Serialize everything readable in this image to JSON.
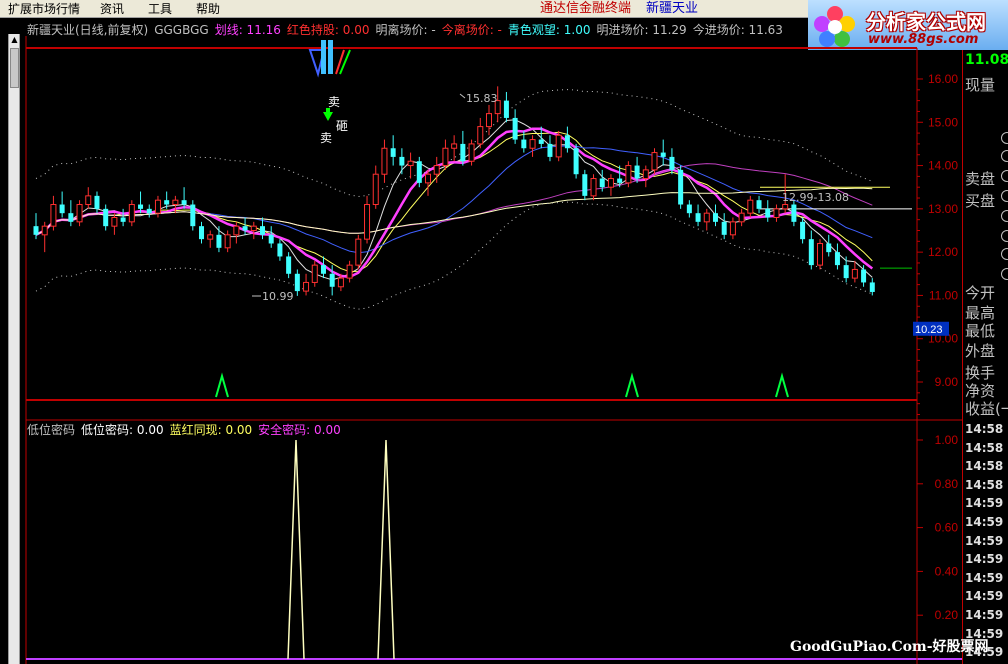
{
  "menu": {
    "items": [
      "扩展市场行情",
      "资讯",
      "工具",
      "帮助"
    ],
    "app_title": "通达信金融终端",
    "stock_name": "新疆天业"
  },
  "logo": {
    "text": "分析家公式网",
    "url": "www.88gs.com"
  },
  "main_title": [
    {
      "text": "新疆天业(日线,前复权)",
      "color": "#c0c0c0"
    },
    {
      "text": "GGGBGG",
      "color": "#c0c0c0"
    },
    {
      "text": "划线: 11.16",
      "color": "#ff40ff"
    },
    {
      "text": "红色持股: 0.00",
      "color": "#ff3030"
    },
    {
      "text": "明离场价: -",
      "color": "#c0c0c0"
    },
    {
      "text": "今离场价: -",
      "color": "#ff3030"
    },
    {
      "text": "青色观望: 1.00",
      "color": "#40ffff"
    },
    {
      "text": "明进场价: 11.29",
      "color": "#c0c0c0"
    },
    {
      "text": "今进场价: 11.63",
      "color": "#c0c0c0"
    }
  ],
  "sub_title": [
    {
      "text": "低位密码",
      "color": "#c0c0c0"
    },
    {
      "text": "低位密码: 0.00",
      "color": "#ffffff"
    },
    {
      "text": "蓝红同现: 0.00",
      "color": "#ffff60"
    },
    {
      "text": "安全密码: 0.00",
      "color": "#ff40ff"
    }
  ],
  "price_axis": [
    "16.00",
    "15.00",
    "14.00",
    "13.00",
    "12.00",
    "11.00",
    "10.00",
    "9.00"
  ],
  "price_highlight": "10.23",
  "sub_axis": [
    "1.00",
    "0.80",
    "0.60",
    "0.40",
    "0.20"
  ],
  "annotations": {
    "high_label": "15.83",
    "low_label": "10.99",
    "range_label": "12.99-13.08",
    "sell_1": "卖",
    "sell_2": "卖",
    "smash": "砸"
  },
  "right_panel": {
    "price": "11.08",
    "labels": [
      "现量",
      "卖盘",
      "买盘",
      "今开",
      "最高",
      "最低",
      "外盘",
      "换手",
      "净资",
      "收益(一"
    ],
    "times": [
      "14:58",
      "14:58",
      "14:58",
      "14:58",
      "14:59",
      "14:59",
      "14:59",
      "14:59",
      "14:59",
      "14:59",
      "14:59",
      "14:59",
      "14:59"
    ]
  },
  "watermark": "GoodGuPiao.Com-好股票网",
  "colors": {
    "up": "#ff3030",
    "down": "#40ffff",
    "grid": "#c00000"
  },
  "chart_data": {
    "type": "candlestick",
    "ylim": [
      8.7,
      16.6
    ],
    "candles": [
      [
        12.6,
        12.9,
        12.3,
        12.4
      ],
      [
        12.4,
        12.7,
        12.0,
        12.6
      ],
      [
        12.6,
        13.3,
        12.5,
        13.1
      ],
      [
        13.1,
        13.4,
        12.8,
        12.9
      ],
      [
        12.9,
        13.2,
        12.6,
        12.7
      ],
      [
        12.7,
        13.2,
        12.6,
        13.1
      ],
      [
        13.1,
        13.5,
        13.0,
        13.3
      ],
      [
        13.3,
        13.4,
        12.9,
        13.0
      ],
      [
        13.0,
        13.1,
        12.5,
        12.6
      ],
      [
        12.6,
        12.9,
        12.4,
        12.8
      ],
      [
        12.8,
        13.0,
        12.6,
        12.7
      ],
      [
        12.7,
        13.2,
        12.6,
        13.1
      ],
      [
        13.1,
        13.4,
        12.9,
        13.0
      ],
      [
        13.0,
        13.1,
        12.8,
        12.9
      ],
      [
        12.9,
        13.3,
        12.8,
        13.2
      ],
      [
        13.2,
        13.4,
        13.0,
        13.1
      ],
      [
        13.1,
        13.3,
        12.9,
        13.2
      ],
      [
        13.2,
        13.5,
        13.0,
        13.1
      ],
      [
        13.1,
        13.2,
        12.5,
        12.6
      ],
      [
        12.6,
        12.7,
        12.2,
        12.3
      ],
      [
        12.3,
        12.5,
        12.1,
        12.4
      ],
      [
        12.4,
        12.6,
        12.0,
        12.1
      ],
      [
        12.1,
        12.5,
        12.0,
        12.4
      ],
      [
        12.4,
        12.7,
        12.2,
        12.6
      ],
      [
        12.6,
        12.8,
        12.4,
        12.5
      ],
      [
        12.5,
        12.7,
        12.3,
        12.6
      ],
      [
        12.6,
        12.8,
        12.3,
        12.4
      ],
      [
        12.4,
        12.6,
        12.1,
        12.2
      ],
      [
        12.2,
        12.3,
        11.8,
        11.9
      ],
      [
        11.9,
        12.0,
        11.4,
        11.5
      ],
      [
        11.5,
        11.6,
        10.99,
        11.1
      ],
      [
        11.1,
        11.5,
        11.0,
        11.3
      ],
      [
        11.3,
        11.8,
        11.2,
        11.7
      ],
      [
        11.7,
        11.9,
        11.4,
        11.5
      ],
      [
        11.5,
        11.7,
        11.0,
        11.2
      ],
      [
        11.2,
        11.5,
        11.1,
        11.4
      ],
      [
        11.4,
        11.8,
        11.3,
        11.7
      ],
      [
        11.7,
        12.4,
        11.6,
        12.3
      ],
      [
        12.3,
        13.3,
        12.2,
        13.1
      ],
      [
        13.1,
        14.0,
        13.0,
        13.8
      ],
      [
        13.8,
        14.6,
        13.6,
        14.4
      ],
      [
        14.4,
        14.7,
        14.0,
        14.2
      ],
      [
        14.2,
        14.4,
        13.8,
        14.0
      ],
      [
        14.0,
        14.3,
        13.7,
        14.1
      ],
      [
        14.1,
        14.2,
        13.5,
        13.6
      ],
      [
        13.6,
        13.9,
        13.3,
        13.8
      ],
      [
        13.8,
        14.2,
        13.6,
        14.0
      ],
      [
        14.0,
        14.6,
        13.9,
        14.4
      ],
      [
        14.4,
        14.7,
        14.1,
        14.5
      ],
      [
        14.5,
        14.8,
        14.0,
        14.1
      ],
      [
        14.1,
        14.6,
        14.0,
        14.5
      ],
      [
        14.5,
        15.1,
        14.4,
        14.9
      ],
      [
        14.9,
        15.4,
        14.7,
        15.2
      ],
      [
        15.2,
        15.83,
        15.0,
        15.5
      ],
      [
        15.5,
        15.7,
        15.0,
        15.1
      ],
      [
        15.1,
        15.3,
        14.5,
        14.6
      ],
      [
        14.6,
        14.8,
        14.3,
        14.4
      ],
      [
        14.4,
        14.7,
        14.2,
        14.6
      ],
      [
        14.6,
        14.9,
        14.4,
        14.5
      ],
      [
        14.5,
        14.7,
        14.1,
        14.2
      ],
      [
        14.2,
        14.8,
        14.1,
        14.7
      ],
      [
        14.7,
        14.9,
        14.3,
        14.4
      ],
      [
        14.4,
        14.5,
        13.7,
        13.8
      ],
      [
        13.8,
        13.9,
        13.2,
        13.3
      ],
      [
        13.3,
        13.8,
        13.2,
        13.7
      ],
      [
        13.7,
        13.9,
        13.4,
        13.5
      ],
      [
        13.5,
        13.8,
        13.3,
        13.7
      ],
      [
        13.7,
        14.0,
        13.5,
        13.6
      ],
      [
        13.6,
        14.1,
        13.5,
        14.0
      ],
      [
        14.0,
        14.2,
        13.6,
        13.7
      ],
      [
        13.7,
        14.0,
        13.5,
        13.9
      ],
      [
        13.9,
        14.4,
        13.8,
        14.3
      ],
      [
        14.3,
        14.6,
        14.0,
        14.2
      ],
      [
        14.2,
        14.4,
        13.8,
        13.9
      ],
      [
        13.9,
        14.0,
        13.0,
        13.1
      ],
      [
        13.1,
        13.2,
        12.8,
        12.9
      ],
      [
        12.9,
        13.1,
        12.6,
        12.7
      ],
      [
        12.7,
        13.0,
        12.5,
        12.9
      ],
      [
        12.9,
        13.1,
        12.6,
        12.7
      ],
      [
        12.7,
        12.9,
        12.3,
        12.4
      ],
      [
        12.4,
        12.8,
        12.3,
        12.7
      ],
      [
        12.7,
        13.0,
        12.6,
        12.9
      ],
      [
        12.9,
        13.3,
        12.8,
        13.2
      ],
      [
        13.2,
        13.3,
        12.9,
        13.0
      ],
      [
        13.0,
        13.2,
        12.7,
        12.8
      ],
      [
        12.8,
        13.1,
        12.7,
        13.0
      ],
      [
        13.0,
        13.8,
        12.9,
        13.1
      ],
      [
        13.1,
        13.2,
        12.6,
        12.7
      ],
      [
        12.7,
        12.8,
        12.2,
        12.3
      ],
      [
        12.3,
        12.5,
        11.6,
        11.7
      ],
      [
        11.7,
        12.3,
        11.6,
        12.2
      ],
      [
        12.2,
        12.4,
        11.9,
        12.0
      ],
      [
        12.0,
        12.2,
        11.6,
        11.7
      ],
      [
        11.7,
        11.9,
        11.3,
        11.4
      ],
      [
        11.4,
        11.8,
        11.3,
        11.6
      ],
      [
        11.6,
        11.7,
        11.2,
        11.3
      ],
      [
        11.3,
        11.4,
        11.0,
        11.08
      ]
    ]
  }
}
